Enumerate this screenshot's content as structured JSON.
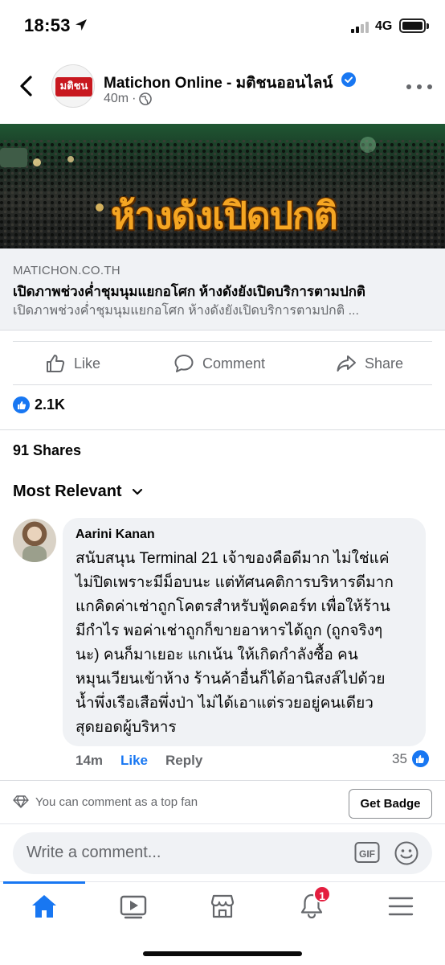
{
  "status_bar": {
    "time": "18:53",
    "network": "4G"
  },
  "post": {
    "page_name": "Matichon Online - มติชนออนไลน์",
    "page_logo_text": "มติชน",
    "time_ago": "40m",
    "meta_sep": "·",
    "image_headline": "ห้างดังเปิดปกติ",
    "link": {
      "domain": "MATICHON.CO.TH",
      "title": "เปิดภาพช่วงค่ำชุมนุมแยกอโศก ห้างดังยังเปิดบริการตามปกติ",
      "description": "เปิดภาพช่วงค่ำชุมนุมแยกอโศก ห้างดังยังเปิดบริการตามปกติ ..."
    }
  },
  "actions": {
    "like": "Like",
    "comment": "Comment",
    "share": "Share"
  },
  "reactions": {
    "count": "2.1K"
  },
  "shares": "91 Shares",
  "comments_sort": "Most Relevant",
  "comment": {
    "author": "Aarini Kanan",
    "lines": [
      "สนับสนุน Terminal 21 เจ้าของคือดีมาก ไม่ใช่แค่",
      "ไม่ปิดเพราะมีม็อบนะ แต่ทัศนคติการบริหารดีมาก",
      "แกคิดค่าเช่าถูกโคตรสำหรับฟู้ดคอร์ท เพื่อให้ร้าน",
      "มีกำไร พอค่าเช่าถูกก็ขายอาหารได้ถูก (ถูกจริงๆ",
      "นะ) คนก็มาเยอะ แกเน้น ให้เกิดกำลังซื้อ คน",
      "หมุนเวียนเข้าห้าง ร้านค้าอื่นก็ได้อานิสงส์ไปด้วย",
      "น้ำพึ่งเรือเสือพึ่งป่า ไม่ได้เอาแต่รวยอยู่คนเดียว",
      "สุดยอดผู้บริหาร"
    ],
    "time_ago": "14m",
    "like_label": "Like",
    "reply_label": "Reply",
    "reaction_count": "35"
  },
  "top_fan": {
    "text": "You can comment as a top fan",
    "button": "Get Badge"
  },
  "composer": {
    "placeholder": "Write a comment..."
  },
  "tabbar": {
    "notification_count": "1"
  },
  "colors": {
    "brand_blue": "#1877f2",
    "badge_red": "#e41e3f",
    "headline_orange": "#f5a623"
  }
}
